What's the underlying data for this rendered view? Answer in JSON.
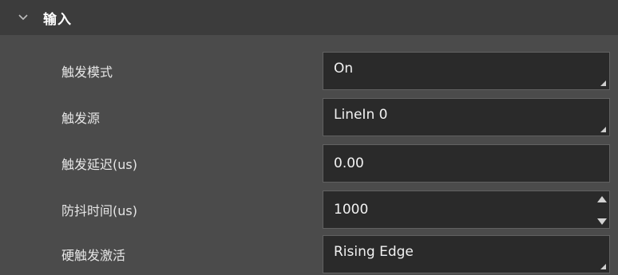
{
  "section": {
    "title": "输入",
    "icon": "chevron-down-icon"
  },
  "rows": [
    {
      "label": "触发模式",
      "value": "On",
      "control": "dropdown"
    },
    {
      "label": "触发源",
      "value": "LineIn 0",
      "control": "dropdown"
    },
    {
      "label": "触发延迟(us)",
      "value": "0.00",
      "control": "text"
    },
    {
      "label": "防抖时间(us)",
      "value": "1000",
      "control": "spinbox"
    },
    {
      "label": "硬触发激活",
      "value": "Rising Edge",
      "control": "dropdown"
    }
  ],
  "colors": {
    "panel_bg": "#4b4b4b",
    "header_bg": "#3c3c3c",
    "field_bg": "#2a2a2a",
    "field_border": "#616161",
    "text": "#f2f2f2"
  }
}
